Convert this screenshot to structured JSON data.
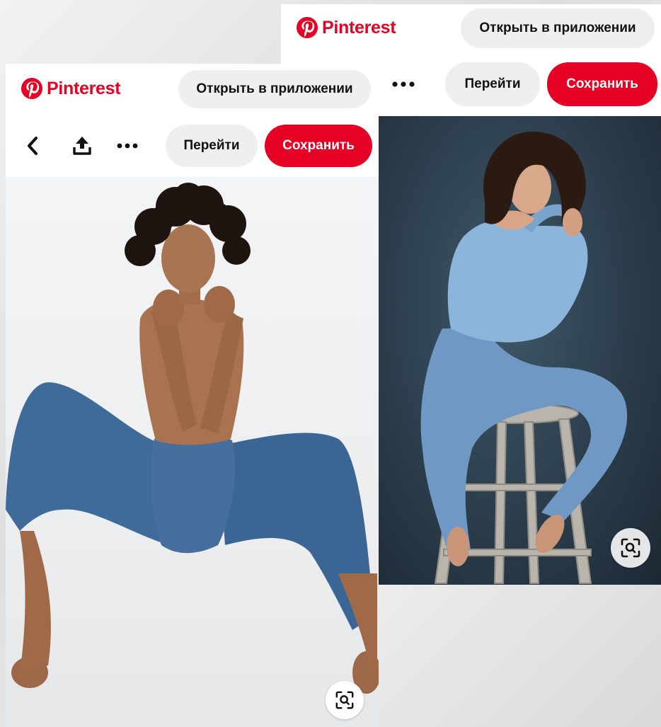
{
  "brand": {
    "name": "Pinterest",
    "color": "#e60023"
  },
  "right_screen": {
    "open_in_app_label": "Открыть в приложении",
    "go_label": "Перейти",
    "save_label": "Сохранить",
    "icons": [
      "pinterest-logo-icon",
      "more-dots-icon",
      "visual-search-icon"
    ]
  },
  "left_screen": {
    "open_in_app_label": "Открыть в приложении",
    "go_label": "Перейти",
    "save_label": "Сохранить",
    "icons": [
      "pinterest-logo-icon",
      "back-chevron-icon",
      "share-icon",
      "more-dots-icon",
      "visual-search-icon"
    ]
  }
}
